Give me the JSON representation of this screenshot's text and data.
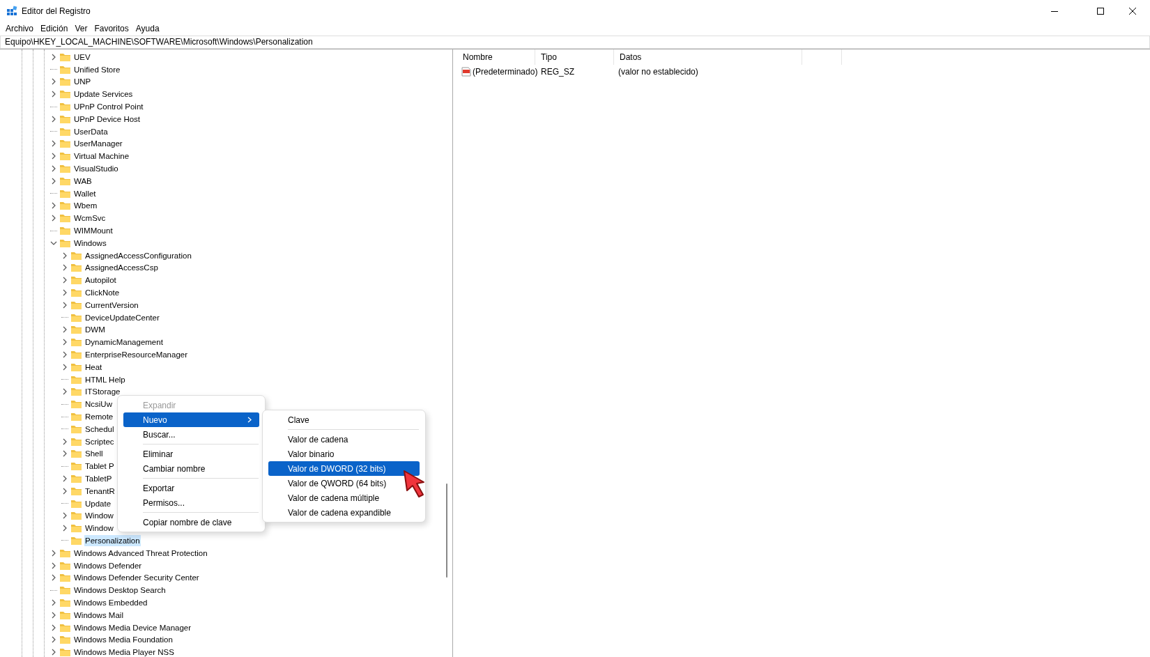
{
  "window": {
    "title": "Editor del Registro"
  },
  "menu_bar": [
    "Archivo",
    "Edición",
    "Ver",
    "Favoritos",
    "Ayuda"
  ],
  "address": "Equipo\\HKEY_LOCAL_MACHINE\\SOFTWARE\\Microsoft\\Windows\\Personalization",
  "tree": [
    {
      "label": "UEV",
      "expandable": true,
      "expanded": false,
      "selected": false
    },
    {
      "label": "Unified Store",
      "expandable": false,
      "selected": false
    },
    {
      "label": "UNP",
      "expandable": true,
      "expanded": false,
      "selected": false
    },
    {
      "label": "Update Services",
      "expandable": true,
      "expanded": false,
      "selected": false
    },
    {
      "label": "UPnP Control Point",
      "expandable": false,
      "selected": false
    },
    {
      "label": "UPnP Device Host",
      "expandable": true,
      "expanded": false,
      "selected": false
    },
    {
      "label": "UserData",
      "expandable": false,
      "selected": false
    },
    {
      "label": "UserManager",
      "expandable": true,
      "expanded": false,
      "selected": false
    },
    {
      "label": "Virtual Machine",
      "expandable": true,
      "expanded": false,
      "selected": false
    },
    {
      "label": "VisualStudio",
      "expandable": true,
      "expanded": false,
      "selected": false
    },
    {
      "label": "WAB",
      "expandable": true,
      "expanded": false,
      "selected": false
    },
    {
      "label": "Wallet",
      "expandable": false,
      "selected": false
    },
    {
      "label": "Wbem",
      "expandable": true,
      "expanded": false,
      "selected": false
    },
    {
      "label": "WcmSvc",
      "expandable": true,
      "expanded": false,
      "selected": false
    },
    {
      "label": "WIMMount",
      "expandable": false,
      "selected": false
    },
    {
      "label": "Windows",
      "expandable": true,
      "expanded": true,
      "selected": false,
      "children": [
        {
          "label": "AssignedAccessConfiguration",
          "expandable": true,
          "expanded": false,
          "selected": false
        },
        {
          "label": "AssignedAccessCsp",
          "expandable": true,
          "expanded": false,
          "selected": false
        },
        {
          "label": "Autopilot",
          "expandable": true,
          "expanded": false,
          "selected": false
        },
        {
          "label": "ClickNote",
          "expandable": true,
          "expanded": false,
          "selected": false
        },
        {
          "label": "CurrentVersion",
          "expandable": true,
          "expanded": false,
          "selected": false
        },
        {
          "label": "DeviceUpdateCenter",
          "expandable": false,
          "selected": false
        },
        {
          "label": "DWM",
          "expandable": true,
          "expanded": false,
          "selected": false
        },
        {
          "label": "DynamicManagement",
          "expandable": true,
          "expanded": false,
          "selected": false
        },
        {
          "label": "EnterpriseResourceManager",
          "expandable": true,
          "expanded": false,
          "selected": false
        },
        {
          "label": "Heat",
          "expandable": true,
          "expanded": false,
          "selected": false
        },
        {
          "label": "HTML Help",
          "expandable": false,
          "selected": false
        },
        {
          "label": "ITStorage",
          "expandable": true,
          "expanded": false,
          "selected": false
        },
        {
          "label": "NcsiUw",
          "expandable": false,
          "selected": false
        },
        {
          "label": "Remote",
          "expandable": false,
          "selected": false
        },
        {
          "label": "Schedul",
          "expandable": false,
          "selected": false
        },
        {
          "label": "Scriptec",
          "expandable": true,
          "expanded": false,
          "selected": false
        },
        {
          "label": "Shell",
          "expandable": true,
          "expanded": false,
          "selected": false
        },
        {
          "label": "Tablet P",
          "expandable": false,
          "selected": false
        },
        {
          "label": "TabletP",
          "expandable": true,
          "expanded": false,
          "selected": false
        },
        {
          "label": "TenantR",
          "expandable": true,
          "expanded": false,
          "selected": false
        },
        {
          "label": "Update",
          "expandable": false,
          "selected": false
        },
        {
          "label": "Window",
          "expandable": true,
          "expanded": false,
          "selected": false
        },
        {
          "label": "Window",
          "expandable": true,
          "expanded": false,
          "selected": false
        },
        {
          "label": "Personalization",
          "expandable": false,
          "selected": true
        }
      ]
    },
    {
      "label": "Windows Advanced Threat Protection",
      "expandable": true,
      "expanded": false,
      "selected": false
    },
    {
      "label": "Windows Defender",
      "expandable": true,
      "expanded": false,
      "selected": false
    },
    {
      "label": "Windows Defender Security Center",
      "expandable": true,
      "expanded": false,
      "selected": false
    },
    {
      "label": "Windows Desktop Search",
      "expandable": false,
      "selected": false
    },
    {
      "label": "Windows Embedded",
      "expandable": true,
      "expanded": false,
      "selected": false
    },
    {
      "label": "Windows Mail",
      "expandable": true,
      "expanded": false,
      "selected": false
    },
    {
      "label": "Windows Media Device Manager",
      "expandable": true,
      "expanded": false,
      "selected": false
    },
    {
      "label": "Windows Media Foundation",
      "expandable": true,
      "expanded": false,
      "selected": false
    },
    {
      "label": "Windows Media Player NSS",
      "expandable": true,
      "expanded": false,
      "selected": false
    }
  ],
  "values_table": {
    "columns": [
      "Nombre",
      "Tipo",
      "Datos"
    ],
    "rows": [
      {
        "name": "(Predeterminado)",
        "type": "REG_SZ",
        "data": "(valor no establecido)"
      }
    ]
  },
  "context_menu": {
    "groups": [
      [
        {
          "label": "Expandir",
          "disabled": true,
          "selected": false,
          "submenu": false
        },
        {
          "label": "Nuevo",
          "disabled": false,
          "selected": true,
          "submenu": true
        },
        {
          "label": "Buscar...",
          "disabled": false,
          "selected": false,
          "submenu": false
        }
      ],
      [
        {
          "label": "Eliminar",
          "disabled": false,
          "selected": false,
          "submenu": false
        },
        {
          "label": "Cambiar nombre",
          "disabled": false,
          "selected": false,
          "submenu": false
        }
      ],
      [
        {
          "label": "Exportar",
          "disabled": false,
          "selected": false,
          "submenu": false
        },
        {
          "label": "Permisos...",
          "disabled": false,
          "selected": false,
          "submenu": false
        }
      ],
      [
        {
          "label": "Copiar nombre de clave",
          "disabled": false,
          "selected": false,
          "submenu": false
        }
      ]
    ]
  },
  "submenu": {
    "groups": [
      [
        {
          "label": "Clave",
          "disabled": false,
          "selected": false,
          "submenu": false
        }
      ],
      [
        {
          "label": "Valor de cadena",
          "disabled": false,
          "selected": false,
          "submenu": false
        },
        {
          "label": "Valor binario",
          "disabled": false,
          "selected": false,
          "submenu": false
        },
        {
          "label": "Valor de DWORD (32 bits)",
          "disabled": false,
          "selected": true,
          "submenu": false
        },
        {
          "label": "Valor de QWORD (64 bits)",
          "disabled": false,
          "selected": false,
          "submenu": false
        },
        {
          "label": "Valor de cadena múltiple",
          "disabled": false,
          "selected": false,
          "submenu": false
        },
        {
          "label": "Valor de cadena expandible",
          "disabled": false,
          "selected": false,
          "submenu": false
        }
      ]
    ]
  }
}
